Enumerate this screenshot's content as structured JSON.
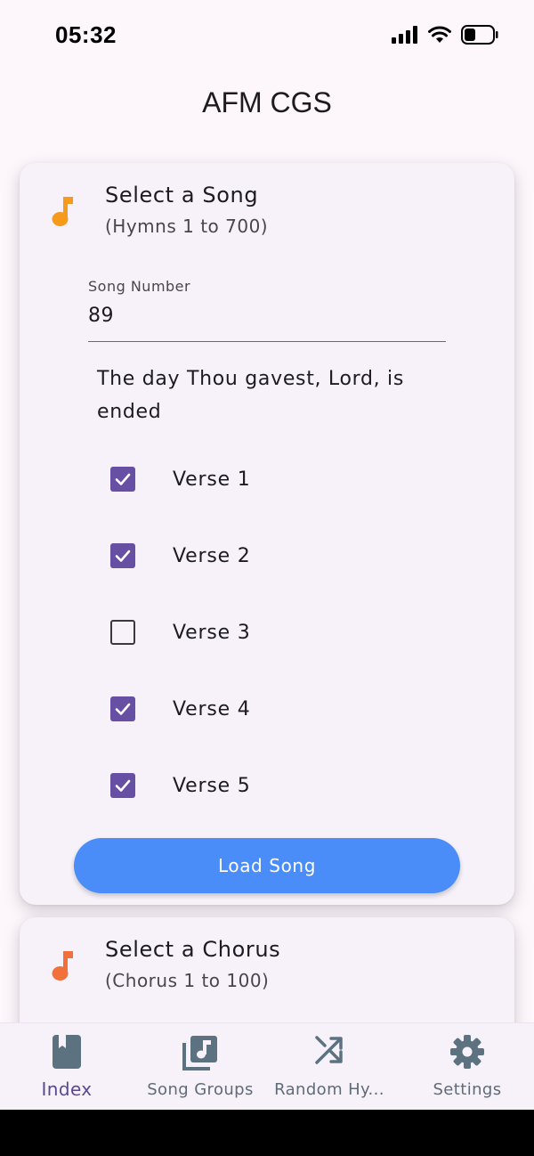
{
  "status_bar": {
    "time": "05:32"
  },
  "app": {
    "title": "AFM CGS"
  },
  "song_card": {
    "icon": "music-note-icon",
    "icon_color": "#f59a1b",
    "title": "Select a Song",
    "subtitle": "(Hymns 1 to 700)",
    "field_label": "Song Number",
    "field_value": "89",
    "song_title": "The day Thou gavest, Lord, is ended",
    "verses": [
      {
        "label": "Verse 1",
        "checked": true
      },
      {
        "label": "Verse 2",
        "checked": true
      },
      {
        "label": "Verse 3",
        "checked": false
      },
      {
        "label": "Verse 4",
        "checked": true
      },
      {
        "label": "Verse 5",
        "checked": true
      }
    ],
    "button_label": "Load Song",
    "button_color": "#4a8cf8"
  },
  "chorus_card": {
    "icon": "music-note-icon",
    "icon_color": "#f2703a",
    "title": "Select a Chorus",
    "subtitle": "(Chorus 1 to 100)"
  },
  "bottom_nav": {
    "items": [
      {
        "label": "Index",
        "icon": "book-icon",
        "active": true
      },
      {
        "label": "Song Groups",
        "icon": "music-library-icon",
        "active": false
      },
      {
        "label": "Random Hy...",
        "icon": "shuffle-icon",
        "active": false
      },
      {
        "label": "Settings",
        "icon": "gear-icon",
        "active": false
      }
    ]
  },
  "colors": {
    "accent": "#6750a4",
    "background": "#fdf7fc",
    "card": "#f7f2fa"
  }
}
